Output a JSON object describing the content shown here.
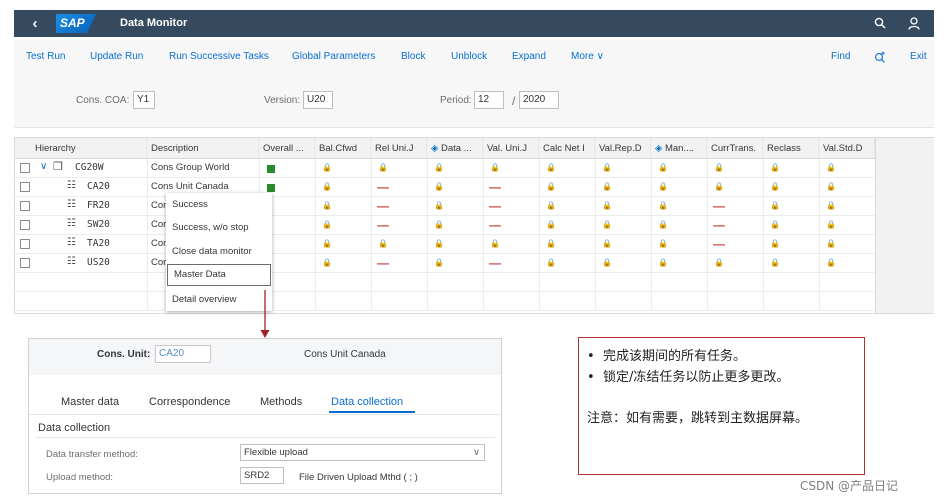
{
  "shell": {
    "logo": "SAP",
    "title": "Data Monitor",
    "back_icon": "chevron-left-icon",
    "search_icon": "search-icon",
    "user_icon": "user-icon"
  },
  "toolbar": {
    "items": [
      "Test Run",
      "Update Run",
      "Run Successive Tasks",
      "Global Parameters",
      "Block",
      "Unblock",
      "Expand",
      "More"
    ],
    "find": "Find",
    "exit": "Exit"
  },
  "header": {
    "coa_label": "Cons. COA:",
    "coa_value": "Y1",
    "version_label": "Version:",
    "version_value": "U20",
    "period_label": "Period:",
    "period_value": "12",
    "year_sep": "/",
    "year_value": "2020"
  },
  "grid": {
    "columns": [
      "Hierarchy",
      "Description",
      "Overall ...",
      "Bal.Cfwd",
      "Rel Uni.J",
      "Data ...",
      "Val. Uni.J",
      "Calc Net I",
      "Val.Rep.D",
      "Man....",
      "CurrTrans.",
      "Reclass",
      "Val.Std.D"
    ],
    "rows": [
      {
        "unit": "CG20W",
        "desc": "Cons Group World",
        "status": [
          "green",
          "lock",
          "lock",
          "lock",
          "lock",
          "lock",
          "lock",
          "lock",
          "lock",
          "lock",
          "lock"
        ]
      },
      {
        "unit": "CA20",
        "desc": "Cons Unit Canada",
        "status": [
          "green",
          "lock",
          "red",
          "lock",
          "red",
          "lock",
          "lock",
          "lock",
          "lock",
          "lock",
          "lock"
        ]
      },
      {
        "unit": "FR20",
        "desc": "Cor",
        "status": [
          "",
          "lock",
          "red",
          "lock",
          "red",
          "lock",
          "lock",
          "lock",
          "red",
          "lock",
          "lock"
        ]
      },
      {
        "unit": "SW20",
        "desc": "Cor",
        "status": [
          "",
          "lock",
          "red",
          "lock",
          "red",
          "lock",
          "lock",
          "lock",
          "red",
          "lock",
          "lock"
        ]
      },
      {
        "unit": "TA20",
        "desc": "Cor",
        "status": [
          "",
          "lock",
          "lock",
          "lock",
          "lock",
          "lock",
          "lock",
          "lock",
          "red",
          "lock",
          "lock"
        ]
      },
      {
        "unit": "US20",
        "desc": "Cor",
        "status": [
          "",
          "lock",
          "red",
          "lock",
          "red",
          "lock",
          "lock",
          "lock",
          "lock",
          "lock",
          "lock"
        ]
      }
    ]
  },
  "context_menu": [
    "Success",
    "Success, w/o stop",
    "Close data monitor",
    "Master Data",
    "Detail overview"
  ],
  "panel": {
    "cons_unit_label": "Cons. Unit:",
    "cons_unit_value": "CA20",
    "cons_unit_desc": "Cons Unit Canada",
    "tabs": [
      "Master data",
      "Correspondence",
      "Methods",
      "Data collection"
    ],
    "section_title": "Data collection",
    "transfer_label": "Data transfer method:",
    "transfer_value": "Flexible upload",
    "upload_label": "Upload method:",
    "upload_value": "SRD2",
    "upload_desc": "File Driven Upload Mthd ( ; )"
  },
  "note": {
    "bullets": [
      "完成该期间的所有任务。",
      "锁定/冻结任务以防止更多更改。"
    ],
    "remark": "注意：如有需要，跳转到主数据屏幕。"
  },
  "watermark": "CSDN @产品日记",
  "colors": {
    "shell": "#354a5f",
    "accent": "#0a6ed1",
    "note_border": "#b03030",
    "arrow": "#a32020"
  }
}
